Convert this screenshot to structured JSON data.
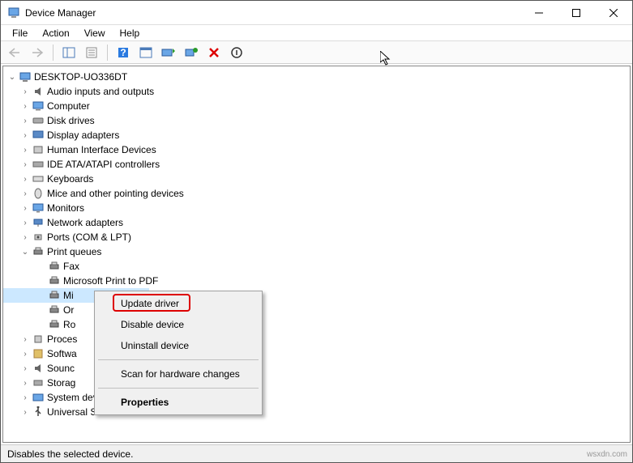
{
  "window": {
    "title": "Device Manager"
  },
  "menubar": {
    "items": [
      "File",
      "Action",
      "View",
      "Help"
    ]
  },
  "tree": {
    "root": "DESKTOP-UO336DT",
    "categories": [
      {
        "label": "Audio inputs and outputs",
        "icon": "audio"
      },
      {
        "label": "Computer",
        "icon": "computer"
      },
      {
        "label": "Disk drives",
        "icon": "disk"
      },
      {
        "label": "Display adapters",
        "icon": "display"
      },
      {
        "label": "Human Interface Devices",
        "icon": "hid"
      },
      {
        "label": "IDE ATA/ATAPI controllers",
        "icon": "ide"
      },
      {
        "label": "Keyboards",
        "icon": "keyboard"
      },
      {
        "label": "Mice and other pointing devices",
        "icon": "mouse"
      },
      {
        "label": "Monitors",
        "icon": "monitor"
      },
      {
        "label": "Network adapters",
        "icon": "network"
      },
      {
        "label": "Ports (COM & LPT)",
        "icon": "port"
      },
      {
        "label": "Print queues",
        "icon": "printer",
        "expanded": true,
        "children": [
          {
            "label": "Fax",
            "icon": "printer"
          },
          {
            "label": "Microsoft Print to PDF",
            "icon": "printer"
          },
          {
            "label": "Mi",
            "icon": "printer",
            "selected": true
          },
          {
            "label": "Or",
            "icon": "printer"
          },
          {
            "label": "Ro",
            "icon": "printer"
          }
        ]
      },
      {
        "label": "Proces",
        "icon": "cpu"
      },
      {
        "label": "Softwa",
        "icon": "software"
      },
      {
        "label": "Sounc",
        "icon": "sound"
      },
      {
        "label": "Storag",
        "icon": "storage"
      },
      {
        "label": "System devices",
        "icon": "system"
      },
      {
        "label": "Universal Serial Bus controllers",
        "icon": "usb"
      }
    ]
  },
  "context_menu": {
    "items": [
      {
        "label": "Update driver",
        "highlighted": true
      },
      {
        "label": "Disable device"
      },
      {
        "label": "Uninstall device"
      },
      {
        "sep": true
      },
      {
        "label": "Scan for hardware changes"
      },
      {
        "sep": true
      },
      {
        "label": "Properties",
        "bold": true
      }
    ]
  },
  "statusbar": {
    "text": "Disables the selected device."
  },
  "watermark": "wsxdn.com"
}
